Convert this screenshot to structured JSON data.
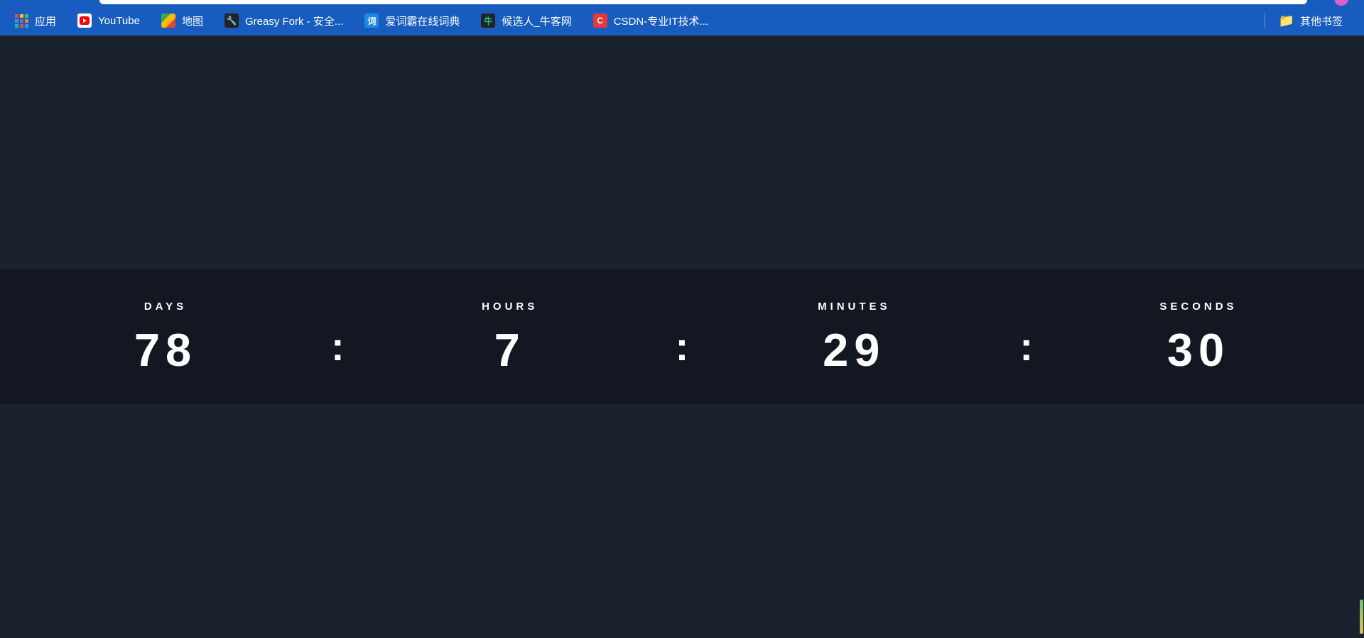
{
  "bookmarks": {
    "apps_label": "应用",
    "items": [
      {
        "label": "YouTube",
        "icon": "youtube-icon"
      },
      {
        "label": "地图",
        "icon": "maps-icon"
      },
      {
        "label": "Greasy Fork - 安全...",
        "icon": "greasy-icon"
      },
      {
        "label": "爱词霸在线词典",
        "icon": "dict-icon"
      },
      {
        "label": "候选人_牛客网",
        "icon": "nowcoder-icon"
      },
      {
        "label": "CSDN-专业IT技术...",
        "icon": "csdn-icon"
      }
    ],
    "other_folder": "其他书签"
  },
  "countdown": {
    "labels": {
      "days": "DAYS",
      "hours": "HOURS",
      "minutes": "MINUTES",
      "seconds": "SECONDS"
    },
    "values": {
      "days": "78",
      "hours": "7",
      "minutes": "29",
      "seconds": "30"
    },
    "sep": ":"
  }
}
